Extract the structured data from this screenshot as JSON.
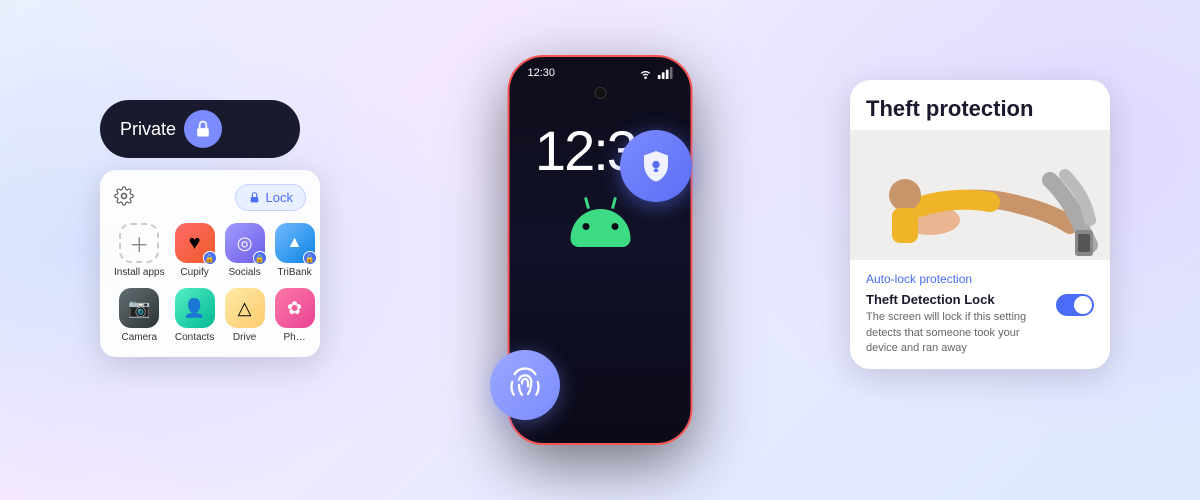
{
  "background": {
    "gradient_start": "#e8f0fe",
    "gradient_end": "#dde8ff"
  },
  "phone": {
    "time": "12:30",
    "status_bar_time": "12:30"
  },
  "private_space": {
    "label": "Private",
    "lock_icon": "🔒",
    "drawer": {
      "lock_button": "Lock",
      "apps": [
        {
          "id": "install",
          "label": "Install apps",
          "type": "install"
        },
        {
          "id": "cupify",
          "label": "Cupify",
          "type": "app",
          "color": "app-cupify",
          "has_badge": true
        },
        {
          "id": "socials",
          "label": "Socials",
          "type": "app",
          "color": "app-socials",
          "has_badge": true
        },
        {
          "id": "tribank",
          "label": "TriBank",
          "type": "app",
          "color": "app-tribank",
          "has_badge": true
        },
        {
          "id": "camera",
          "label": "Camera",
          "type": "app",
          "color": "app-camera",
          "has_badge": false
        },
        {
          "id": "contacts",
          "label": "Contacts",
          "type": "app",
          "color": "app-contacts",
          "has_badge": false
        },
        {
          "id": "drive",
          "label": "Drive",
          "type": "app",
          "color": "app-drive",
          "has_badge": false
        },
        {
          "id": "photos",
          "label": "Photos",
          "type": "app",
          "color": "app-photos",
          "has_badge": false
        }
      ]
    }
  },
  "theft_protection": {
    "title": "Theft protection",
    "auto_lock_label": "Auto-lock protection",
    "detection_title": "Theft Detection Lock",
    "detection_description": "The screen will lock if this setting detects that someone took your device and ran away",
    "toggle_state": "on"
  },
  "floating": {
    "shield_icon": "shield-key",
    "fingerprint_icon": "fingerprint"
  },
  "android_robot": {
    "color": "#3ddc84"
  }
}
